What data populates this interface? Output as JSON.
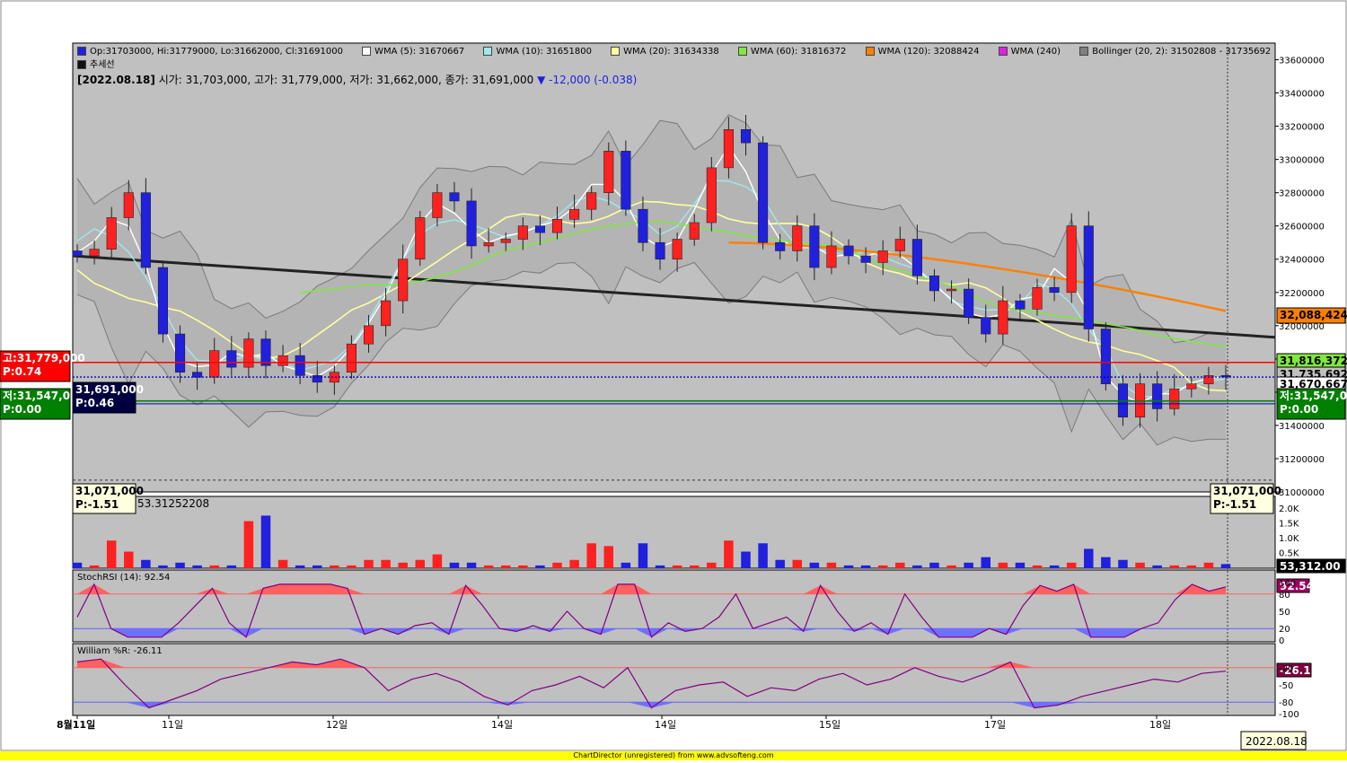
{
  "header": {
    "ohlc": "Op:31703000, Hi:31779000, Lo:31662000, Cl:31691000",
    "wma5": "WMA (5): 31670667",
    "wma10": "WMA (10): 31651800",
    "wma20": "WMA (20): 31634338",
    "wma60": "WMA (60): 31816372",
    "wma120": "WMA (120): 32088424",
    "wma240": "WMA (240)",
    "bollinger": "Bollinger (20, 2): 31502808 - 31735692",
    "trendline": "추세선",
    "date": "[2022.08.18]",
    "open_label": "시가: 31,703,000,",
    "high_label": "고가: 31,779,000,",
    "low_label": "저가: 31,662,000,",
    "close_label": "종가: 31,691,000",
    "change": "▼ -12,000 (-0.038)"
  },
  "colors": {
    "up": "#ff2020",
    "down": "#2020dd",
    "wma5": "#ffffff",
    "wma10": "#a0e8f0",
    "wma20": "#ffffa0",
    "wma60": "#80e840",
    "wma120": "#ff8000",
    "wma240": "#e020e0",
    "bollinger": "#808080",
    "trend": "#222222",
    "bg": "#c0c0c0"
  },
  "left_tags": {
    "high": "고:31,779,000",
    "high_p": "P:0.74",
    "low": "저:31,547,000",
    "low_p": "P:0.00",
    "cur": "31,691,000",
    "cur_p": "P:0.46",
    "bottom": "31,071,000",
    "bottom_p": "P:-1.51"
  },
  "right_tags": {
    "wma120": "32,088,424",
    "wma60": "31,816,372",
    "boll_up": "31,735,692",
    "wma5": "31,670,667",
    "low_r": "저:31,547,000",
    "low_rp": "P:0.00",
    "bottom": "31,071,000",
    "bottom_p": "P:-1.51",
    "volume": "53,312.00",
    "stoch": "92.54",
    "will": "-26.11"
  },
  "volume_label": "53.31252208",
  "stoch_label": "StochRSI (14): 92.54",
  "will_label": "William %R: -26.11",
  "footer": "ChartDirector (unregistered) from www.advsofteng.com",
  "date_box": "2022.08.18",
  "chart_data": {
    "type": "candlestick",
    "price_axis": {
      "ticks": [
        "33600000",
        "33400000",
        "33200000",
        "33000000",
        "32800000",
        "32600000",
        "32400000",
        "32200000",
        "32000000",
        "31800000",
        "31600000",
        "31400000",
        "31200000",
        "31000000"
      ],
      "ylim": [
        31000000,
        33700000
      ]
    },
    "x_axis": {
      "tick_labels": [
        "8월11일",
        "11일",
        "12일",
        "14일",
        "14일",
        "15일",
        "17일",
        "18일"
      ]
    },
    "volume_axis": {
      "ticks": [
        "2.0K",
        "1.5K",
        "1.0K",
        "0.5K"
      ]
    },
    "stoch_axis": {
      "ticks": [
        "100",
        "80",
        "50",
        "20",
        "0"
      ]
    },
    "will_axis": {
      "ticks": [
        "-20",
        "-50",
        "-80",
        "-100"
      ]
    },
    "last_bar": {
      "open": 31703000,
      "high": 31779000,
      "low": 31662000,
      "close": 31691000,
      "change": -12000
    },
    "indicators": {
      "wma5": 31670667,
      "wma10": 31651800,
      "wma20": 31634338,
      "wma60": 31816372,
      "wma120": 32088424,
      "bollinger_lower": 31502808,
      "bollinger_upper": 31735692,
      "volume": 53312,
      "stoch_rsi": 92.54,
      "williams_r": -26.11
    },
    "anchors": [
      32420000,
      32460000,
      32650000,
      32800000,
      32350000,
      31950000,
      31720000,
      31690000,
      31850000,
      31750000,
      31920000,
      31760000,
      31820000,
      31700000,
      31660000,
      31720000,
      31890000,
      32000000,
      32150000,
      32400000,
      32650000,
      32800000,
      32750000,
      32480000,
      32500000,
      32520000,
      32600000,
      32560000,
      32640000,
      32700000,
      32800000,
      33050000,
      32700000,
      32500000,
      32400000,
      32520000,
      32620000,
      32950000,
      33180000,
      33100000,
      32500000,
      32450000,
      32600000,
      32350000,
      32480000,
      32420000,
      32380000,
      32450000,
      32520000,
      32300000,
      32210000,
      32220000,
      32050000,
      31950000,
      32150000,
      32100000,
      32230000,
      32200000,
      32600000,
      31980000,
      31650000,
      31450000,
      31650000,
      31500000,
      31620000,
      31650000,
      31700000,
      31691000
    ],
    "volumes": [
      0.2,
      0.1,
      1.0,
      0.6,
      0.3,
      0.1,
      0.2,
      0.1,
      0.1,
      0.1,
      1.7,
      1.9,
      0.3,
      0.1,
      0.1,
      0.1,
      0.1,
      0.3,
      0.3,
      0.2,
      0.3,
      0.5,
      0.2,
      0.2,
      0.1,
      0.1,
      0.1,
      0.1,
      0.2,
      0.3,
      0.9,
      0.8,
      0.2,
      0.9,
      0.1,
      0.1,
      0.1,
      0.2,
      1.0,
      0.6,
      0.9,
      0.3,
      0.3,
      0.2,
      0.2,
      0.1,
      0.1,
      0.1,
      0.2,
      0.1,
      0.2,
      0.1,
      0.2,
      0.4,
      0.2,
      0.2,
      0.1,
      0.1,
      0.2,
      0.7,
      0.4,
      0.3,
      0.2,
      0.1,
      0.1,
      0.1,
      0.2,
      0.15
    ],
    "stoch_rsi": [
      40,
      97,
      20,
      5,
      5,
      5,
      30,
      60,
      90,
      30,
      5,
      90,
      97,
      97,
      97,
      97,
      90,
      10,
      20,
      10,
      25,
      30,
      10,
      95,
      60,
      20,
      15,
      25,
      15,
      50,
      20,
      10,
      97,
      97,
      5,
      30,
      15,
      20,
      40,
      80,
      20,
      30,
      40,
      15,
      95,
      50,
      15,
      30,
      10,
      80,
      40,
      5,
      5,
      5,
      20,
      10,
      60,
      95,
      85,
      97,
      5,
      5,
      5,
      20,
      30,
      70,
      97,
      85,
      92.54
    ],
    "williams_r": [
      -10,
      -5,
      -50,
      -90,
      -75,
      -60,
      -40,
      -30,
      -20,
      -10,
      -15,
      -5,
      -20,
      -60,
      -40,
      -30,
      -45,
      -70,
      -85,
      -60,
      -50,
      -35,
      -55,
      -20,
      -90,
      -60,
      -50,
      -45,
      -70,
      -55,
      -60,
      -40,
      -30,
      -50,
      -40,
      -20,
      -35,
      -45,
      -30,
      -10,
      -90,
      -85,
      -70,
      -60,
      -50,
      -40,
      -45,
      -30,
      -26.11
    ]
  }
}
